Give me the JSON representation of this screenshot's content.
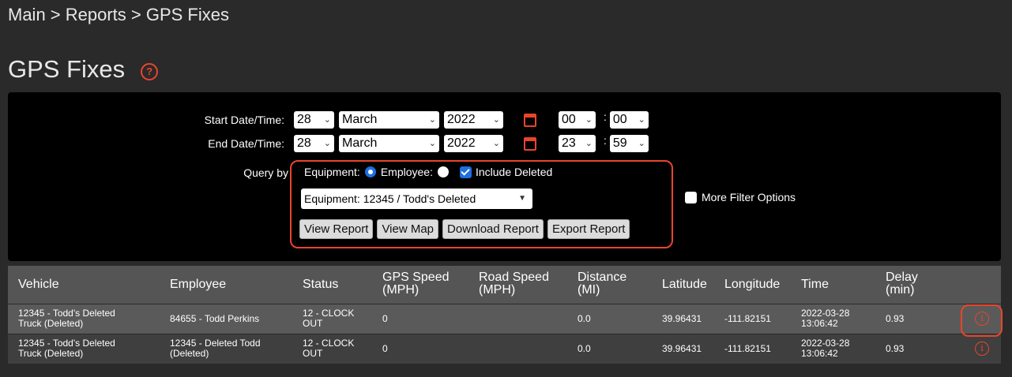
{
  "breadcrumb": "Main > Reports > GPS Fixes",
  "page_title": "GPS Fixes",
  "help_glyph": "?",
  "filters": {
    "start_label": "Start Date/Time:",
    "end_label": "End Date/Time:",
    "start": {
      "day": "28",
      "month": "March",
      "year": "2022",
      "hour": "00",
      "minute": "00"
    },
    "end": {
      "day": "28",
      "month": "March",
      "year": "2022",
      "hour": "23",
      "minute": "59"
    },
    "query_by_label": "Query by",
    "equipment_label": "Equipment:",
    "employee_label": "Employee:",
    "include_deleted_label": "Include Deleted",
    "equipment_select": "Equipment: 12345 / Todd's Deleted",
    "more_filter_label": "More Filter Options",
    "buttons": {
      "view_report": "View Report",
      "view_map": "View Map",
      "download_report": "Download Report",
      "export_report": "Export Report"
    }
  },
  "table": {
    "headers": {
      "vehicle": "Vehicle",
      "employee": "Employee",
      "status": "Status",
      "gps_speed": [
        "GPS Speed",
        "(MPH)"
      ],
      "road_speed": [
        "Road Speed",
        "(MPH)"
      ],
      "distance": [
        "Distance",
        "(MI)"
      ],
      "latitude": "Latitude",
      "longitude": "Longitude",
      "time": "Time",
      "delay": [
        "Delay",
        "(min)"
      ]
    },
    "rows": [
      {
        "vehicle": [
          "12345 - Todd's Deleted",
          "Truck (Deleted)"
        ],
        "employee": [
          "84655 - Todd Perkins",
          ""
        ],
        "status": [
          "12 - CLOCK",
          "OUT"
        ],
        "gps_speed": "0",
        "road_speed": "",
        "distance": "0.0",
        "latitude": "39.96431",
        "longitude": "-111.82151",
        "time": [
          "2022-03-28",
          "13:06:42"
        ],
        "delay": "0.93"
      },
      {
        "vehicle": [
          "12345 - Todd's Deleted",
          "Truck (Deleted)"
        ],
        "employee": [
          "12345 - Deleted Todd",
          "(Deleted)"
        ],
        "status": [
          "12 - CLOCK",
          "OUT"
        ],
        "gps_speed": "0",
        "road_speed": "",
        "distance": "0.0",
        "latitude": "39.96431",
        "longitude": "-111.82151",
        "time": [
          "2022-03-28",
          "13:06:42"
        ],
        "delay": "0.93"
      }
    ]
  },
  "info_glyph": "i",
  "colors": {
    "accent": "#e8452c",
    "selected_blue": "#1e6fe0",
    "row_odd": "#5a5a5a",
    "row_even": "#3f3f3f"
  }
}
